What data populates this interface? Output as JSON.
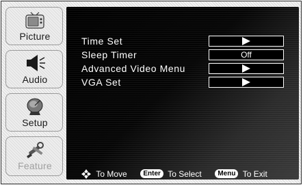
{
  "sidebar": {
    "items": [
      {
        "label": "Picture",
        "icon": "tv-icon"
      },
      {
        "label": "Audio",
        "icon": "speaker-icon"
      },
      {
        "label": "Setup",
        "icon": "satellite-dish-icon"
      },
      {
        "label": "Feature",
        "icon": "tools-icon"
      }
    ]
  },
  "menu": {
    "rows": [
      {
        "label": "Time Set",
        "value": "",
        "value_icon": "arrow-right-icon"
      },
      {
        "label": "Sleep Timer",
        "value": "Off"
      },
      {
        "label": "Advanced Video Menu",
        "value": "",
        "value_icon": "arrow-right-icon"
      },
      {
        "label": "VGA Set",
        "value": "",
        "value_icon": "arrow-right-icon"
      }
    ]
  },
  "footer": {
    "move_label": "To Move",
    "enter_key": "Enter",
    "select_label": "To Select",
    "menu_key": "Menu",
    "exit_label": "To Exit"
  },
  "colors": {
    "panel_background": "#111111",
    "text": "#ffffff",
    "sidebar_text": "#1a1a1a",
    "disabled_text": "#a0a0a0"
  }
}
